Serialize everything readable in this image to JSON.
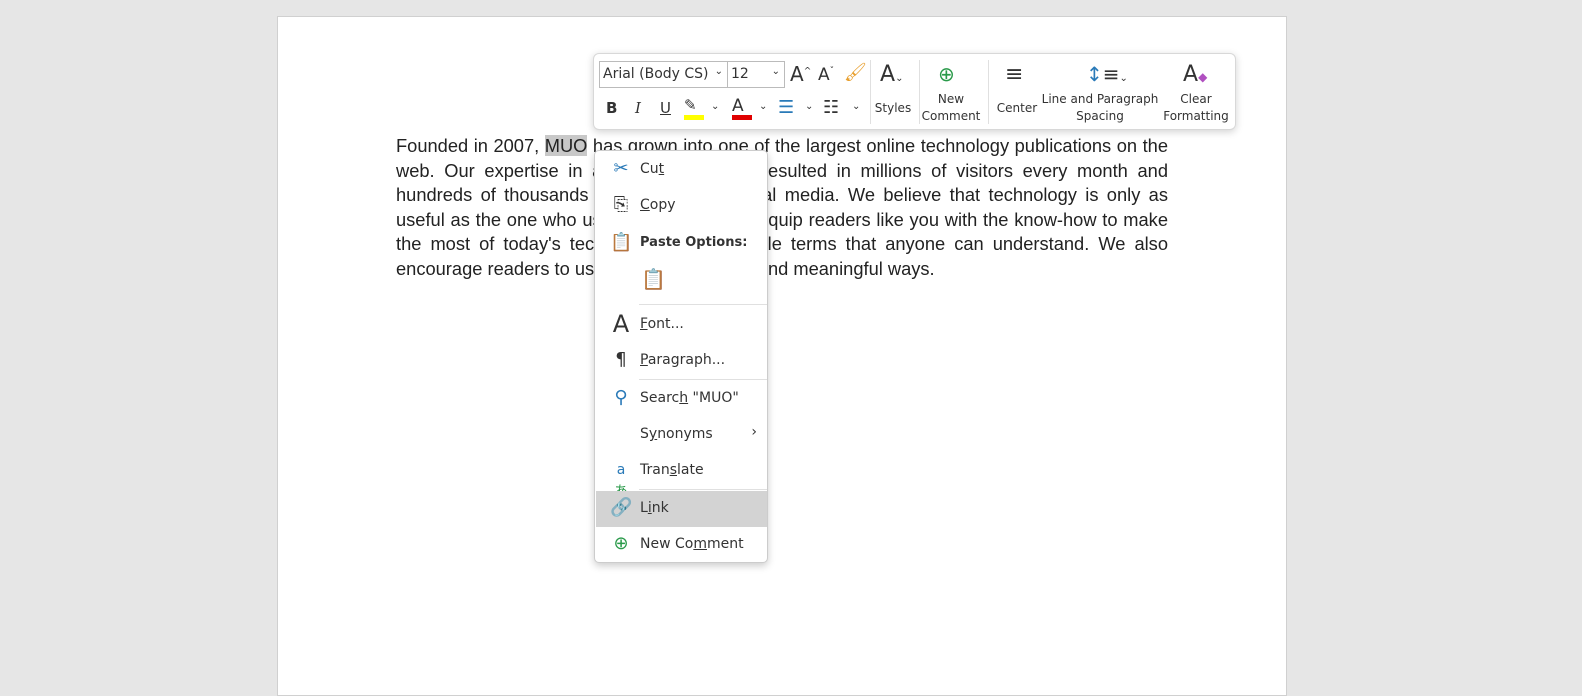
{
  "document": {
    "before": "Founded in 2007, ",
    "selected": "MUO",
    "after": " has grown into one of the largest online technology publications on the web. Our expertise in all things tech has resulted in millions of visitors every month and hundreds of thousands of followers on social media. We believe that technology is only as useful as the one who uses it. Our aim is to equip readers like you with the know-how to make the most of today's tech, explained in simple terms that anyone can understand. We also encourage readers to use tech in productive and meaningful ways."
  },
  "mini_toolbar": {
    "font_name": "Arial (Body CS)",
    "font_size": "12",
    "styles": "Styles",
    "new_comment": [
      "New",
      "Comment"
    ],
    "center": "Center",
    "line_spacing": [
      "Line and Paragraph",
      "Spacing"
    ],
    "clear_formatting": [
      "Clear",
      "Formatting"
    ],
    "bold": "B",
    "italic": "I",
    "underline": "U",
    "highlight_color": "#ffff00",
    "font_color": "#e00000"
  },
  "context_menu": {
    "cut": {
      "pre": "Cu",
      "u": "t",
      "post": ""
    },
    "copy": {
      "pre": "",
      "u": "C",
      "post": "opy"
    },
    "paste_options": "Paste Options:",
    "font": {
      "pre": "",
      "u": "F",
      "post": "ont..."
    },
    "paragraph": {
      "pre": "",
      "u": "P",
      "post": "aragraph..."
    },
    "search": {
      "pre": "Searc",
      "u": "h",
      "post": " \"MUO\""
    },
    "synonyms": {
      "pre": "S",
      "u": "y",
      "post": "nonyms"
    },
    "translate": {
      "pre": "Tran",
      "u": "s",
      "post": "late"
    },
    "link": {
      "pre": "L",
      "u": "i",
      "post": "nk"
    },
    "new_comment": {
      "pre": "New Co",
      "u": "m",
      "post": "ment"
    }
  }
}
